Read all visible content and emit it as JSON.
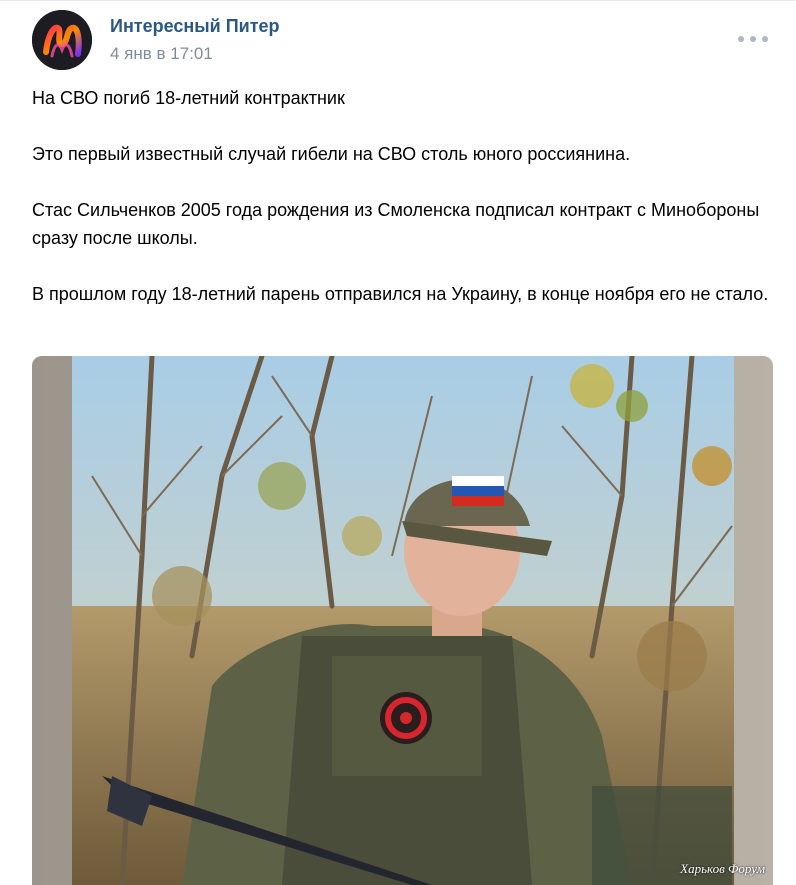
{
  "post": {
    "author_name": "Интересный Питер",
    "date": "4 янв в 17:01",
    "more_icon": "more-horizontal-icon",
    "paragraphs": [
      "На СВО погиб 18-летний контрактник",
      "Это первый известный случай гибели на СВО столь юного россиянина.",
      "Стас Сильченков 2005 года рождения из Смоленска подписал контракт с Минобороны сразу после школы.",
      "В прошлом году 18-летний парень отправился на Украину, в конце ноября его не стало."
    ],
    "photo": {
      "watermark": "Харьков Форум"
    }
  },
  "colors": {
    "author_link": "#2a5885",
    "meta_text": "#818c99",
    "avatar_gradient": [
      "#ff2d55",
      "#ff8a00",
      "#7b2ff7"
    ]
  }
}
